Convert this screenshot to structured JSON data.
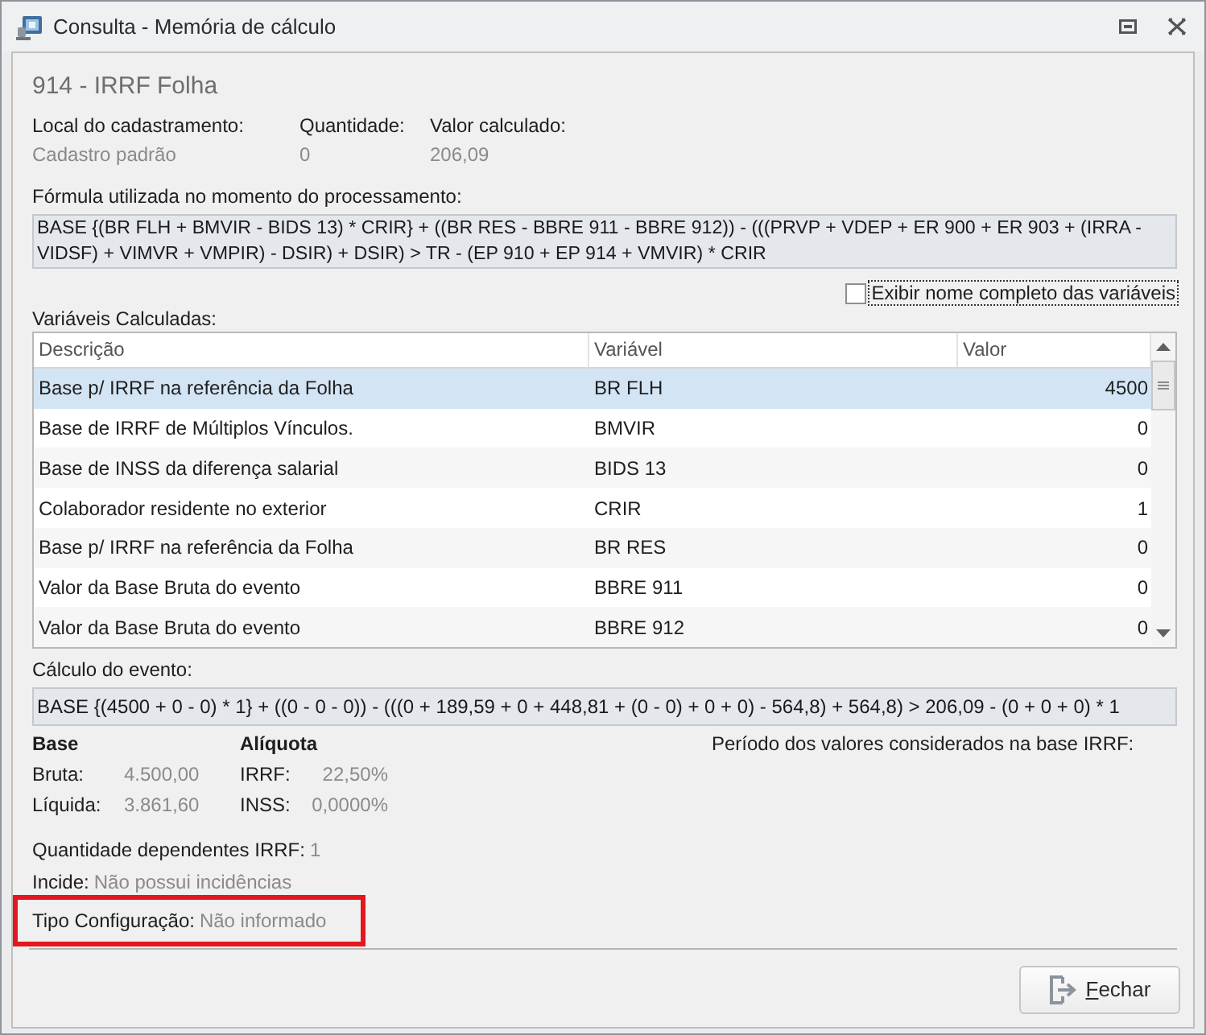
{
  "window": {
    "title": "Consulta - Memória de cálculo"
  },
  "event": {
    "title": "914 - IRRF Folha"
  },
  "fields": [
    {
      "label": "Local do cadastramento:",
      "value": "Cadastro padrão"
    },
    {
      "label": "Quantidade:",
      "value": "0"
    },
    {
      "label": "Valor calculado:",
      "value": "206,09"
    }
  ],
  "formula": {
    "label": "Fórmula utilizada no momento do processamento:",
    "value": "BASE {(BR FLH + BMVIR - BIDS 13) * CRIR} + ((BR RES - BBRE 911 - BBRE 912)) - (((PRVP + VDEP + ER 900 + ER 903 + (IRRA - VIDSF) + VIMVR + VMPIR) - DSIR) + DSIR) > TR - (EP 910 + EP 914 + VMVIR) * CRIR"
  },
  "show_full_names": {
    "label": "Exibir nome completo das variáveis",
    "checked": false,
    "focused": true
  },
  "variables": {
    "label": "Variáveis Calculadas:",
    "columns": [
      "Descrição",
      "Variável",
      "Valor"
    ],
    "rows": [
      {
        "description": "Base p/ IRRF na referência da Folha",
        "variable": "BR FLH",
        "value": "4500",
        "selected": true
      },
      {
        "description": "Base de IRRF de Múltiplos Vínculos.",
        "variable": "BMVIR",
        "value": "0",
        "selected": false
      },
      {
        "description": "Base de INSS da diferença salarial",
        "variable": "BIDS 13",
        "value": "0",
        "selected": false
      },
      {
        "description": "Colaborador residente no exterior",
        "variable": "CRIR",
        "value": "1",
        "selected": false
      },
      {
        "description": "Base p/ IRRF na referência da Folha",
        "variable": "BR RES",
        "value": "0",
        "selected": false
      },
      {
        "description": "Valor da Base Bruta do evento",
        "variable": "BBRE 911",
        "value": "0",
        "selected": false
      },
      {
        "description": "Valor da Base Bruta do evento",
        "variable": "BBRE 912",
        "value": "0",
        "selected": false
      }
    ]
  },
  "calculation": {
    "label": "Cálculo do evento:",
    "value": "BASE {(4500 + 0 - 0) * 1} + ((0 - 0 - 0)) - (((0 + 189,59 + 0 + 448,81 + (0 - 0) + 0 + 0) - 564,8) + 564,8) > 206,09 - (0 + 0 + 0) * 1"
  },
  "base": {
    "title": "Base",
    "items": [
      {
        "label": "Bruta:",
        "value": "4.500,00"
      },
      {
        "label": "Líquida:",
        "value": "3.861,60"
      }
    ]
  },
  "rate": {
    "title": "Alíquota",
    "items": [
      {
        "label": "IRRF:",
        "value": "22,50%"
      },
      {
        "label": "INSS:",
        "value": "0,0000%"
      }
    ]
  },
  "period": {
    "label": "Período dos valores considerados na base IRRF:"
  },
  "details": [
    {
      "label": "Quantidade dependentes IRRF:",
      "value": "1",
      "highlighted": false
    },
    {
      "label": "Incide:",
      "value": "Não possui incidências",
      "highlighted": false
    },
    {
      "label": "Tipo Configuração:",
      "value": "Não informado",
      "highlighted": true
    }
  ],
  "buttons": [
    {
      "label": "Fechar"
    }
  ]
}
